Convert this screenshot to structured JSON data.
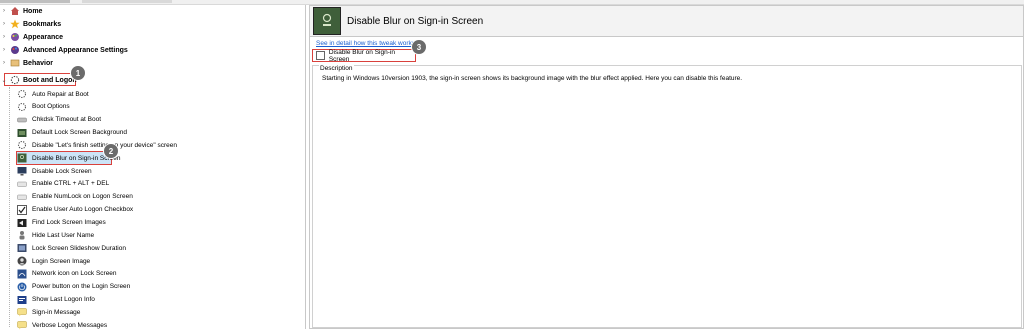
{
  "colors": {
    "highlight": "#d9413c",
    "link": "#1a5fd0",
    "selection": "#cce4f7"
  },
  "tree": {
    "categories": [
      {
        "label": "Home",
        "icon": "home-icon"
      },
      {
        "label": "Bookmarks",
        "icon": "star-icon"
      },
      {
        "label": "Appearance",
        "icon": "palette-icon"
      },
      {
        "label": "Advanced Appearance Settings",
        "icon": "palette-icon"
      },
      {
        "label": "Behavior",
        "icon": "behavior-icon"
      },
      {
        "label": "Boot and Logon",
        "icon": "boot-icon"
      }
    ],
    "items": [
      {
        "label": "Auto Repair at Boot",
        "icon": "spinner-icon"
      },
      {
        "label": "Boot Options",
        "icon": "spinner-icon"
      },
      {
        "label": "Chkdsk Timeout at Boot",
        "icon": "disk-icon"
      },
      {
        "label": "Default Lock Screen Background",
        "icon": "image-icon"
      },
      {
        "label": "Disable \"Let's finish setting up your device\" screen",
        "icon": "spinner-icon"
      },
      {
        "label": "Disable Blur on Sign-in Screen",
        "icon": "blur-icon"
      },
      {
        "label": "Disable Lock Screen",
        "icon": "monitor-icon"
      },
      {
        "label": "Enable CTRL + ALT + DEL",
        "icon": "keyboard-icon"
      },
      {
        "label": "Enable NumLock on Logon Screen",
        "icon": "keyboard-icon"
      },
      {
        "label": "Enable User Auto Logon Checkbox",
        "icon": "checkbox-icon"
      },
      {
        "label": "Find Lock Screen Images",
        "icon": "search-image-icon"
      },
      {
        "label": "Hide Last User Name",
        "icon": "user-icon"
      },
      {
        "label": "Lock Screen Slideshow Duration",
        "icon": "slideshow-icon"
      },
      {
        "label": "Login Screen Image",
        "icon": "user-circle-icon"
      },
      {
        "label": "Network icon on Lock Screen",
        "icon": "network-icon"
      },
      {
        "label": "Power button on the Login Screen",
        "icon": "power-icon"
      },
      {
        "label": "Show Last Logon Info",
        "icon": "info-icon"
      },
      {
        "label": "Sign-in Message",
        "icon": "message-icon"
      },
      {
        "label": "Verbose Logon Messages",
        "icon": "message-icon"
      }
    ],
    "badges": {
      "boot": "1",
      "item": "2"
    }
  },
  "panel": {
    "title": "Disable Blur on Sign-in Screen",
    "link": "See in detail how this tweak works",
    "option_label": "Disable Blur on Sign-in Screen",
    "option_checked": false,
    "badge": "3",
    "description_legend": "Description",
    "description_text": "Starting in Windows 10version 1903, the sign-in screen shows its background image with the blur effect applied. Here you can disable this feature."
  }
}
